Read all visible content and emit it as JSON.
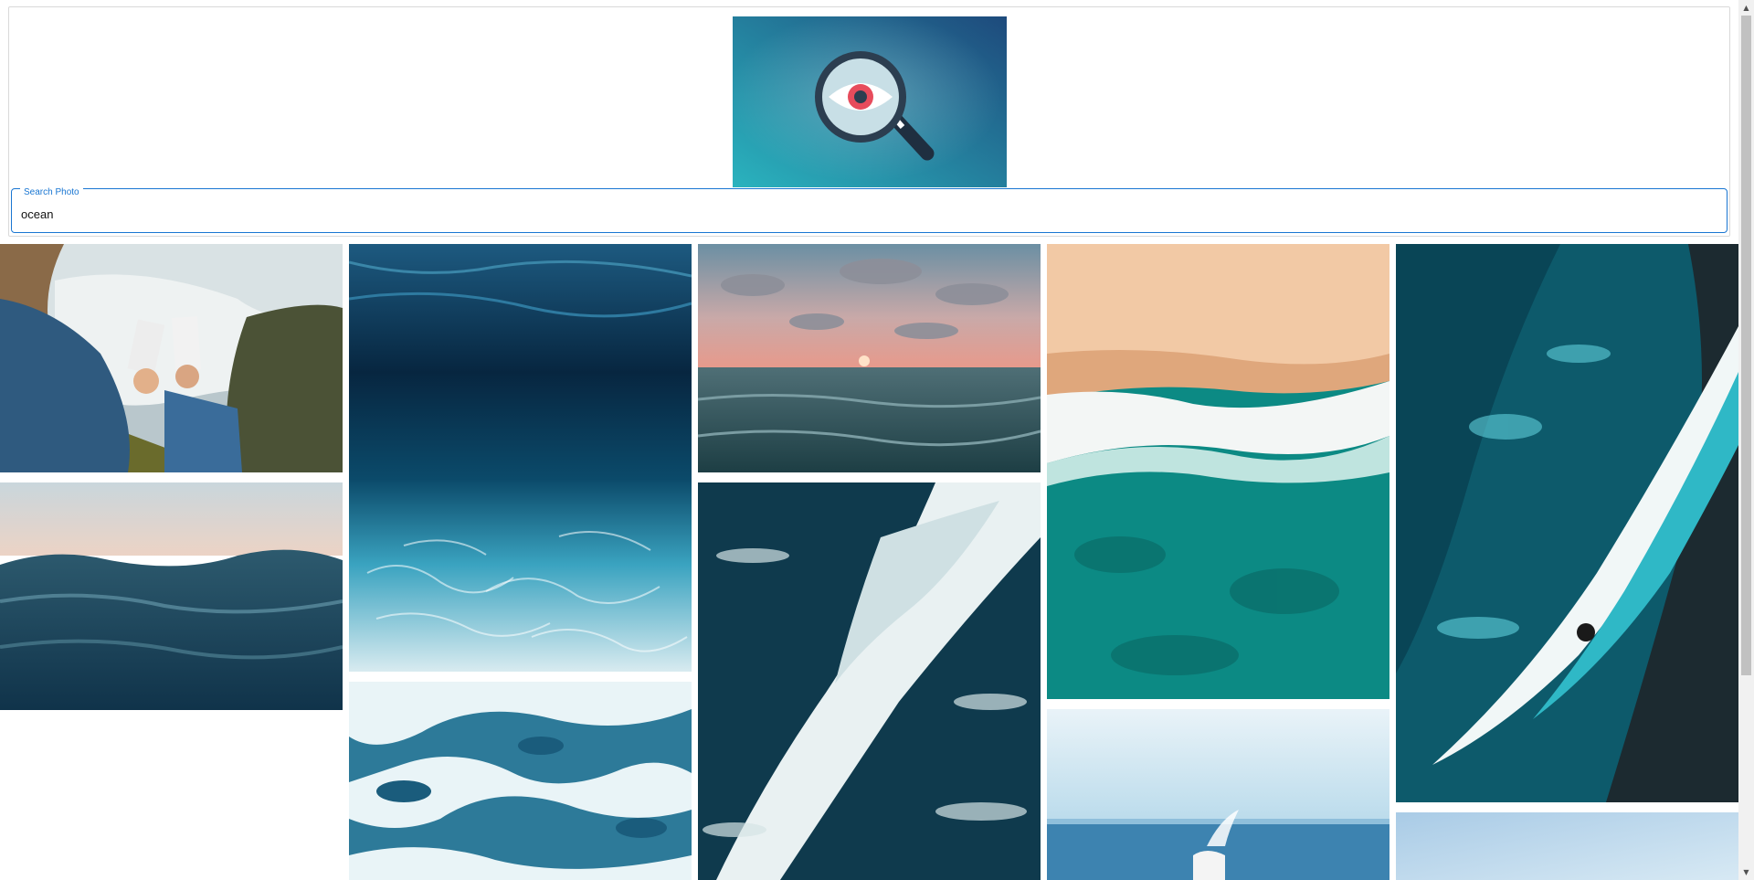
{
  "search": {
    "label": "Search Photo",
    "value": "ocean"
  },
  "logo": {
    "icon": "magnifier-eye-icon",
    "colors": {
      "bg_start": "#2ab3be",
      "bg_end": "#1e4a7c",
      "ring": "#2c3e50",
      "iris": "#e74c5c"
    }
  },
  "gallery": {
    "photos": [
      {
        "name": "photo-couple-boxed-water",
        "subject": "people holding boxed water cartons by the sea"
      },
      {
        "name": "photo-calm-water-surface",
        "subject": "dark blue calm water surface at dusk"
      },
      {
        "name": "photo-underwater-light",
        "subject": "underwater view with light caustics on sand"
      },
      {
        "name": "photo-foamy-waves",
        "subject": "foamy turquoise waves from above"
      },
      {
        "name": "photo-sunset-ocean",
        "subject": "ocean at sunset with clouds"
      },
      {
        "name": "photo-aerial-dark-wave",
        "subject": "aerial view of dark sea with white wave"
      },
      {
        "name": "photo-beach-aerial",
        "subject": "aerial beach with sand and teal water"
      },
      {
        "name": "photo-boxed-water-splash",
        "subject": "boxed water carton splashing in sea"
      },
      {
        "name": "photo-aerial-surf-rocks",
        "subject": "aerial surf breaking on rocks"
      },
      {
        "name": "photo-blue-sky-bottom",
        "subject": "pale blue sky"
      }
    ]
  },
  "scrollbar": {
    "up": "▲",
    "down": "▼"
  }
}
